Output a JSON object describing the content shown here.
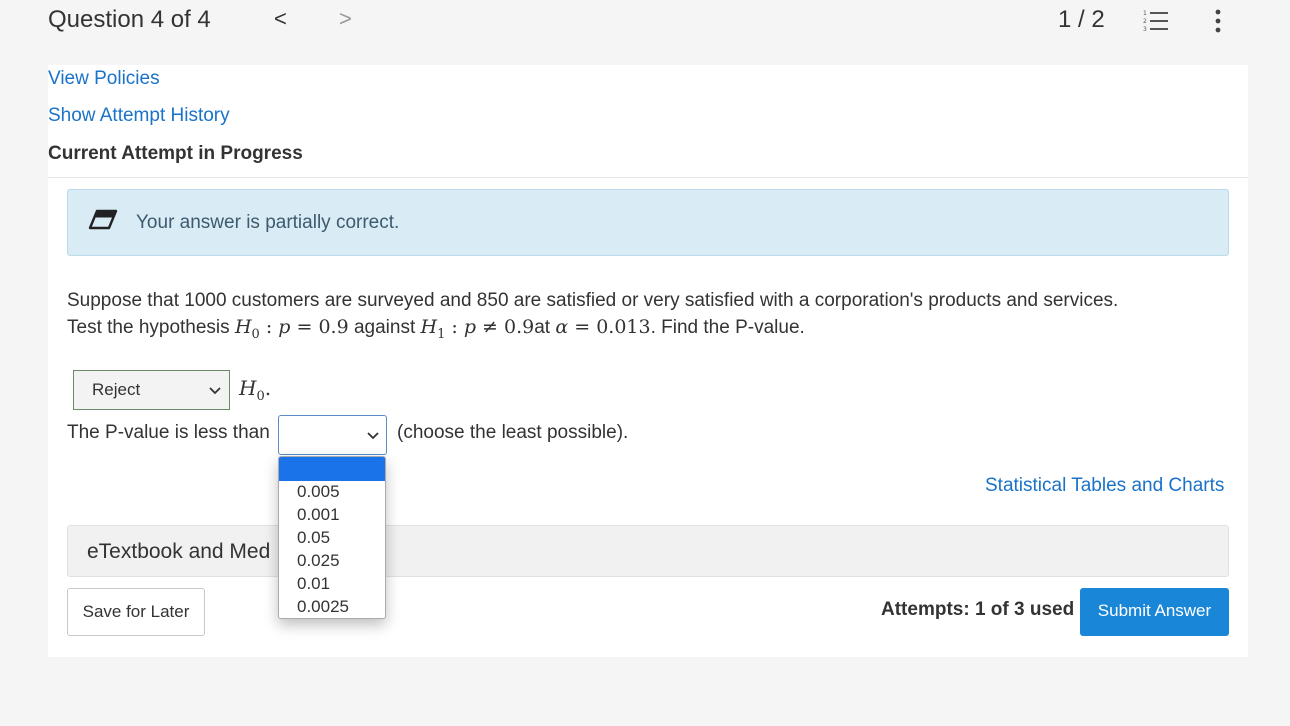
{
  "header": {
    "question_label": "Question 4 of 4",
    "prev": "<",
    "next": ">",
    "page": "1 / 2"
  },
  "links": {
    "view_policies": "View Policies",
    "attempt_history": "Show Attempt History"
  },
  "attempt_status": "Current Attempt in Progress",
  "feedback": "Your answer is partially correct.",
  "question": {
    "line1": "Suppose that 1000 customers are surveyed and 850 are satisfied or very satisfied with a corporation's products and services.",
    "line2_prefix": "Test the hypothesis ",
    "line2_mid": " against ",
    "line2_suffix": ". Find the P-value."
  },
  "decision_select": {
    "value": "Reject"
  },
  "pvalue": {
    "label": "The P-value is less than",
    "selected": "",
    "note": "(choose the least possible).",
    "options": [
      "",
      "0.005",
      "0.001",
      "0.05",
      "0.025",
      "0.01",
      "0.0025"
    ]
  },
  "statistical_tables_link": "Statistical Tables and Charts",
  "etextbook_label": "eTextbook and Med",
  "buttons": {
    "save": "Save for Later",
    "submit": "Submit Answer"
  },
  "attempts": "Attempts: 1 of 3 used",
  "colors": {
    "link": "#1a73c8",
    "feedback_bg": "#d9ecf6",
    "submit_bg": "#1a86d8",
    "dropdown_highlight": "#1a73e8"
  }
}
